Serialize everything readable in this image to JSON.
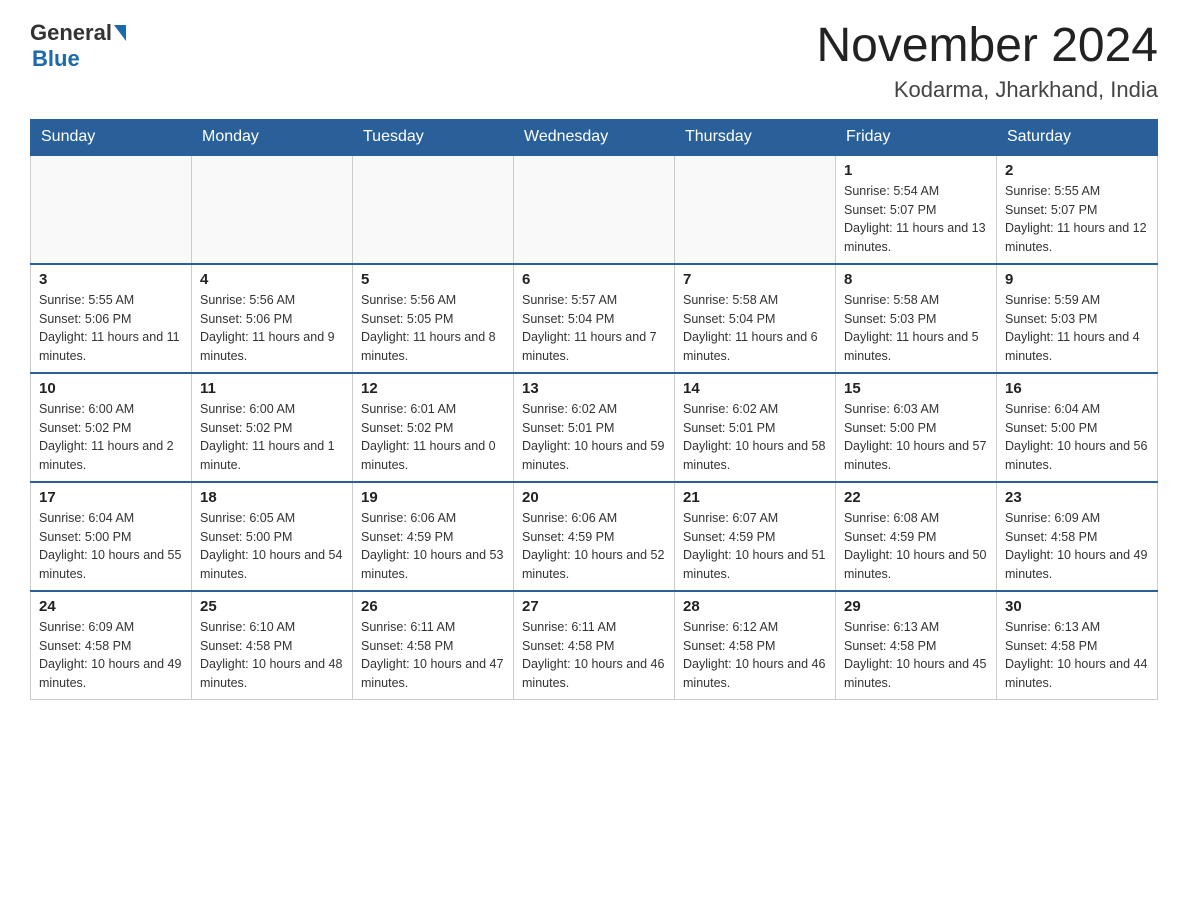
{
  "header": {
    "logo_general": "General",
    "logo_blue": "Blue",
    "title": "November 2024",
    "location": "Kodarma, Jharkhand, India"
  },
  "days_of_week": [
    "Sunday",
    "Monday",
    "Tuesday",
    "Wednesday",
    "Thursday",
    "Friday",
    "Saturday"
  ],
  "weeks": [
    {
      "days": [
        {
          "num": "",
          "info": ""
        },
        {
          "num": "",
          "info": ""
        },
        {
          "num": "",
          "info": ""
        },
        {
          "num": "",
          "info": ""
        },
        {
          "num": "",
          "info": ""
        },
        {
          "num": "1",
          "info": "Sunrise: 5:54 AM\nSunset: 5:07 PM\nDaylight: 11 hours and 13 minutes."
        },
        {
          "num": "2",
          "info": "Sunrise: 5:55 AM\nSunset: 5:07 PM\nDaylight: 11 hours and 12 minutes."
        }
      ]
    },
    {
      "days": [
        {
          "num": "3",
          "info": "Sunrise: 5:55 AM\nSunset: 5:06 PM\nDaylight: 11 hours and 11 minutes."
        },
        {
          "num": "4",
          "info": "Sunrise: 5:56 AM\nSunset: 5:06 PM\nDaylight: 11 hours and 9 minutes."
        },
        {
          "num": "5",
          "info": "Sunrise: 5:56 AM\nSunset: 5:05 PM\nDaylight: 11 hours and 8 minutes."
        },
        {
          "num": "6",
          "info": "Sunrise: 5:57 AM\nSunset: 5:04 PM\nDaylight: 11 hours and 7 minutes."
        },
        {
          "num": "7",
          "info": "Sunrise: 5:58 AM\nSunset: 5:04 PM\nDaylight: 11 hours and 6 minutes."
        },
        {
          "num": "8",
          "info": "Sunrise: 5:58 AM\nSunset: 5:03 PM\nDaylight: 11 hours and 5 minutes."
        },
        {
          "num": "9",
          "info": "Sunrise: 5:59 AM\nSunset: 5:03 PM\nDaylight: 11 hours and 4 minutes."
        }
      ]
    },
    {
      "days": [
        {
          "num": "10",
          "info": "Sunrise: 6:00 AM\nSunset: 5:02 PM\nDaylight: 11 hours and 2 minutes."
        },
        {
          "num": "11",
          "info": "Sunrise: 6:00 AM\nSunset: 5:02 PM\nDaylight: 11 hours and 1 minute."
        },
        {
          "num": "12",
          "info": "Sunrise: 6:01 AM\nSunset: 5:02 PM\nDaylight: 11 hours and 0 minutes."
        },
        {
          "num": "13",
          "info": "Sunrise: 6:02 AM\nSunset: 5:01 PM\nDaylight: 10 hours and 59 minutes."
        },
        {
          "num": "14",
          "info": "Sunrise: 6:02 AM\nSunset: 5:01 PM\nDaylight: 10 hours and 58 minutes."
        },
        {
          "num": "15",
          "info": "Sunrise: 6:03 AM\nSunset: 5:00 PM\nDaylight: 10 hours and 57 minutes."
        },
        {
          "num": "16",
          "info": "Sunrise: 6:04 AM\nSunset: 5:00 PM\nDaylight: 10 hours and 56 minutes."
        }
      ]
    },
    {
      "days": [
        {
          "num": "17",
          "info": "Sunrise: 6:04 AM\nSunset: 5:00 PM\nDaylight: 10 hours and 55 minutes."
        },
        {
          "num": "18",
          "info": "Sunrise: 6:05 AM\nSunset: 5:00 PM\nDaylight: 10 hours and 54 minutes."
        },
        {
          "num": "19",
          "info": "Sunrise: 6:06 AM\nSunset: 4:59 PM\nDaylight: 10 hours and 53 minutes."
        },
        {
          "num": "20",
          "info": "Sunrise: 6:06 AM\nSunset: 4:59 PM\nDaylight: 10 hours and 52 minutes."
        },
        {
          "num": "21",
          "info": "Sunrise: 6:07 AM\nSunset: 4:59 PM\nDaylight: 10 hours and 51 minutes."
        },
        {
          "num": "22",
          "info": "Sunrise: 6:08 AM\nSunset: 4:59 PM\nDaylight: 10 hours and 50 minutes."
        },
        {
          "num": "23",
          "info": "Sunrise: 6:09 AM\nSunset: 4:58 PM\nDaylight: 10 hours and 49 minutes."
        }
      ]
    },
    {
      "days": [
        {
          "num": "24",
          "info": "Sunrise: 6:09 AM\nSunset: 4:58 PM\nDaylight: 10 hours and 49 minutes."
        },
        {
          "num": "25",
          "info": "Sunrise: 6:10 AM\nSunset: 4:58 PM\nDaylight: 10 hours and 48 minutes."
        },
        {
          "num": "26",
          "info": "Sunrise: 6:11 AM\nSunset: 4:58 PM\nDaylight: 10 hours and 47 minutes."
        },
        {
          "num": "27",
          "info": "Sunrise: 6:11 AM\nSunset: 4:58 PM\nDaylight: 10 hours and 46 minutes."
        },
        {
          "num": "28",
          "info": "Sunrise: 6:12 AM\nSunset: 4:58 PM\nDaylight: 10 hours and 46 minutes."
        },
        {
          "num": "29",
          "info": "Sunrise: 6:13 AM\nSunset: 4:58 PM\nDaylight: 10 hours and 45 minutes."
        },
        {
          "num": "30",
          "info": "Sunrise: 6:13 AM\nSunset: 4:58 PM\nDaylight: 10 hours and 44 minutes."
        }
      ]
    }
  ]
}
